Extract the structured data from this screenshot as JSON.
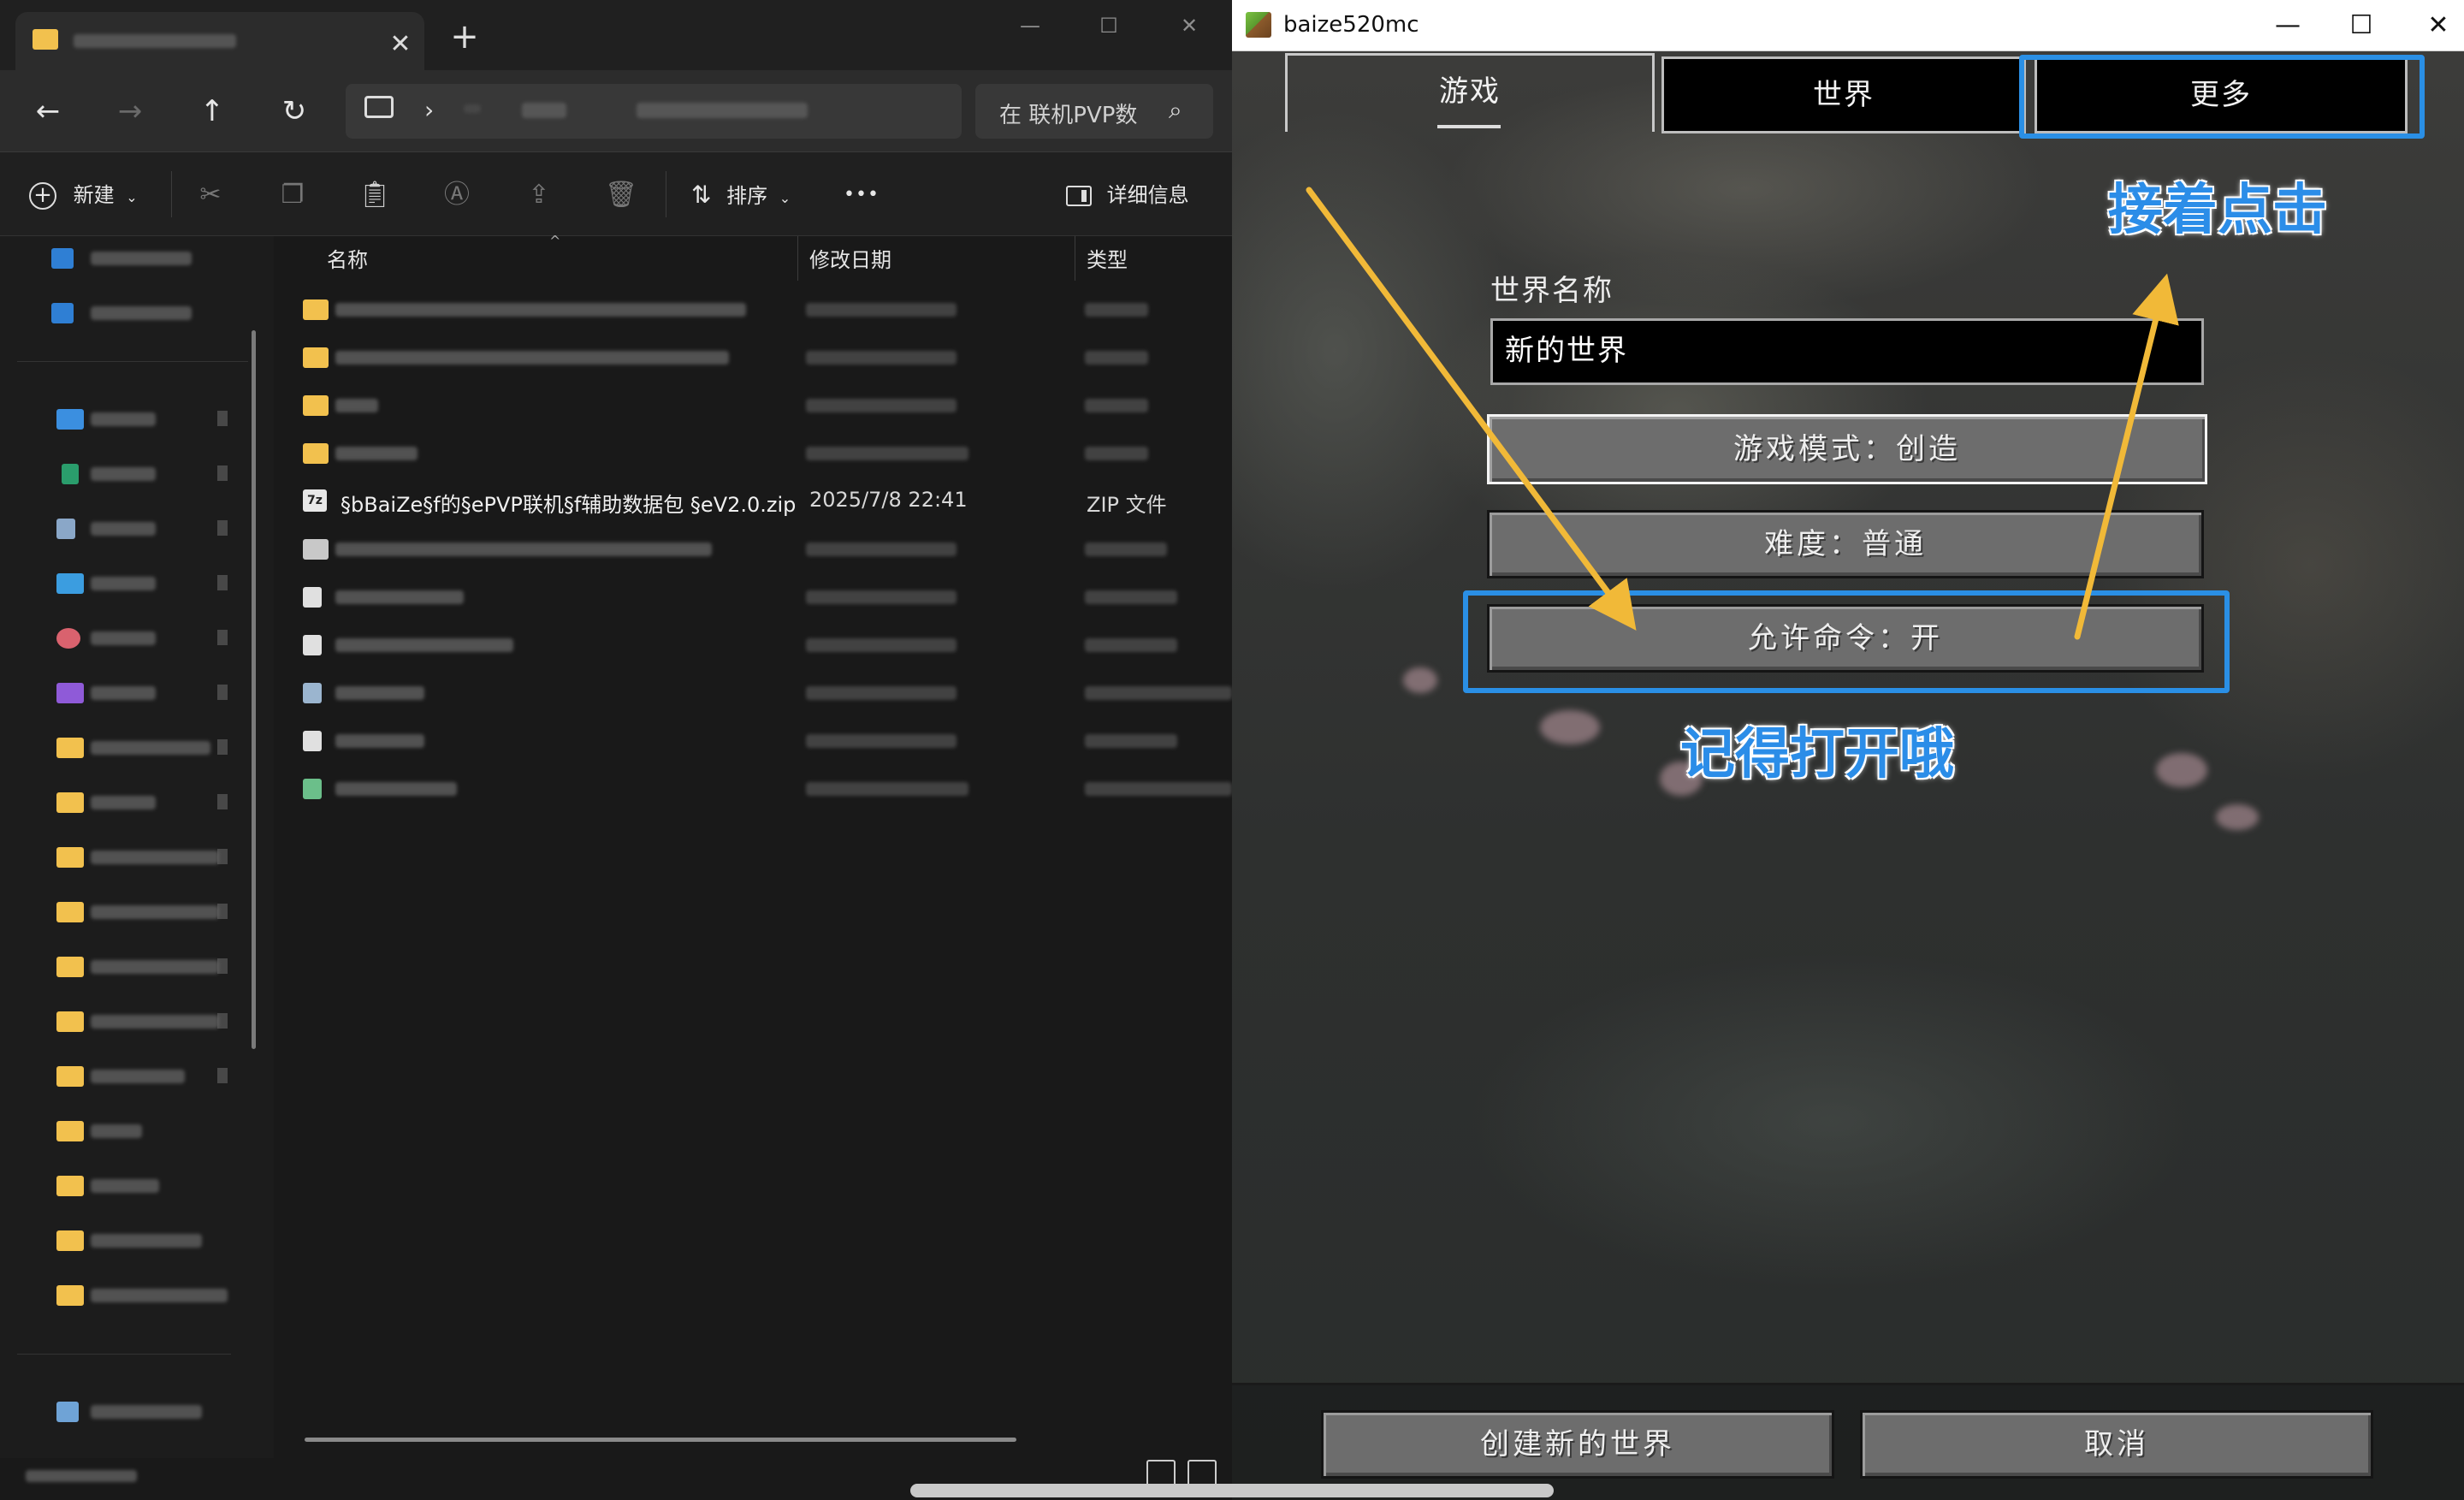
{
  "explorer": {
    "tab_close": "✕",
    "new_tab": "+",
    "window_controls": {
      "minimize": "—",
      "maximize": "☐",
      "close": "✕"
    },
    "nav": {
      "back": "←",
      "forward": "→",
      "up": "↑",
      "refresh": "↻",
      "path_chevron": "›"
    },
    "search_placeholder": "在 联机PVP数",
    "toolbar": {
      "new_label": "新建",
      "sort_label": "排序",
      "more_label": "•••",
      "details_label": "详细信息"
    },
    "columns": {
      "name": "名称",
      "modified": "修改日期",
      "type": "类型"
    },
    "visible_file": {
      "name": "§bBaiZe§f的§ePVP联机§f辅助数据包 §eV2.0.zip",
      "modified": "2025/7/8 22:41",
      "type": "ZIP 文件",
      "icon_label": "7z"
    }
  },
  "minecraft": {
    "window_title": "baize520mc",
    "window_controls": {
      "minimize": "—",
      "maximize": "☐",
      "close": "✕"
    },
    "tabs": {
      "game": "游戏",
      "world": "世界",
      "more": "更多"
    },
    "world_name_label": "世界名称",
    "world_name_value": "新的世界",
    "buttons": {
      "game_mode": "游戏模式：创造",
      "difficulty": "难度：普通",
      "allow_commands": "允许命令：开",
      "create": "创建新的世界",
      "cancel": "取消"
    },
    "annotations": {
      "click_next": "接着点击",
      "remember_enable": "记得打开哦"
    }
  },
  "colors": {
    "highlight_blue": "#2a8fe5",
    "arrow_yellow": "#f1b938",
    "folder_yellow": "#f2c14e"
  }
}
